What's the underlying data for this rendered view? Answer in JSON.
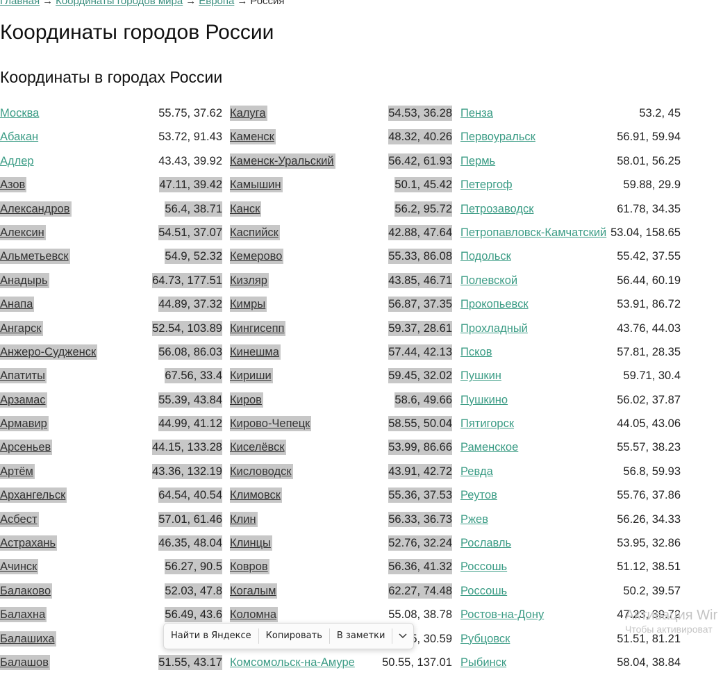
{
  "breadcrumb": {
    "items": [
      "Главная",
      "Координаты городов мира",
      "Европа"
    ],
    "current": "Россия",
    "separator": "→"
  },
  "page_title": "Координаты городов России",
  "section_title": "Координаты в городах России",
  "colors": {
    "link": "#3b9c85",
    "selection": "#c7c7c7"
  },
  "columns": [
    [
      {
        "name": "Москва",
        "coords": "55.75, 37.62",
        "sel": false
      },
      {
        "name": "Абакан",
        "coords": "53.72, 91.43",
        "sel": false
      },
      {
        "name": "Адлер",
        "coords": "43.43, 39.92",
        "sel": false
      },
      {
        "name": "Азов",
        "coords": "47.11, 39.42",
        "sel": true
      },
      {
        "name": "Александров",
        "coords": "56.4, 38.71",
        "sel": true
      },
      {
        "name": "Алексин",
        "coords": "54.51, 37.07",
        "sel": true
      },
      {
        "name": "Альметьевск",
        "coords": "54.9, 52.32",
        "sel": true
      },
      {
        "name": "Анадырь",
        "coords": "64.73, 177.51",
        "sel": true
      },
      {
        "name": "Анапа",
        "coords": "44.89, 37.32",
        "sel": true
      },
      {
        "name": "Ангарск",
        "coords": "52.54, 103.89",
        "sel": true
      },
      {
        "name": "Анжеро-Судженск",
        "coords": "56.08, 86.03",
        "sel": true
      },
      {
        "name": "Апатиты",
        "coords": "67.56, 33.4",
        "sel": true
      },
      {
        "name": "Арзамас",
        "coords": "55.39, 43.84",
        "sel": true
      },
      {
        "name": "Армавир",
        "coords": "44.99, 41.12",
        "sel": true
      },
      {
        "name": "Арсеньев",
        "coords": "44.15, 133.28",
        "sel": true
      },
      {
        "name": "Артём",
        "coords": "43.36, 132.19",
        "sel": true
      },
      {
        "name": "Архангельск",
        "coords": "64.54, 40.54",
        "sel": true
      },
      {
        "name": "Асбест",
        "coords": "57.01, 61.46",
        "sel": true
      },
      {
        "name": "Астрахань",
        "coords": "46.35, 48.04",
        "sel": true
      },
      {
        "name": "Ачинск",
        "coords": "56.27, 90.5",
        "sel": true
      },
      {
        "name": "Балаково",
        "coords": "52.03, 47.8",
        "sel": true
      },
      {
        "name": "Балахна",
        "coords": "56.49, 43.6",
        "sel": true
      },
      {
        "name": "Балашиха",
        "coords": "5",
        "sel": true
      },
      {
        "name": "Балашов",
        "coords": "51.55, 43.17",
        "sel": true
      }
    ],
    [
      {
        "name": "Калуга",
        "coords": "54.53, 36.28",
        "sel": true
      },
      {
        "name": "Каменск",
        "coords": "48.32, 40.26",
        "sel": true
      },
      {
        "name": "Каменск-Уральский",
        "coords": "56.42, 61.93",
        "sel": true
      },
      {
        "name": "Камышин",
        "coords": "50.1, 45.42",
        "sel": true
      },
      {
        "name": "Канск",
        "coords": "56.2, 95.72",
        "sel": true
      },
      {
        "name": "Каспийск",
        "coords": "42.88, 47.64",
        "sel": true
      },
      {
        "name": "Кемерово",
        "coords": "55.33, 86.08",
        "sel": true
      },
      {
        "name": "Кизляр",
        "coords": "43.85, 46.71",
        "sel": true
      },
      {
        "name": "Кимры",
        "coords": "56.87, 37.35",
        "sel": true
      },
      {
        "name": "Кингисепп",
        "coords": "59.37, 28.61",
        "sel": true
      },
      {
        "name": "Кинешма",
        "coords": "57.44, 42.13",
        "sel": true
      },
      {
        "name": "Кириши",
        "coords": "59.45, 32.02",
        "sel": true
      },
      {
        "name": "Киров",
        "coords": "58.6, 49.66",
        "sel": true
      },
      {
        "name": "Кирово-Чепецк",
        "coords": "58.55, 50.04",
        "sel": true
      },
      {
        "name": "Киселёвск",
        "coords": "53.99, 86.66",
        "sel": true
      },
      {
        "name": "Кисловодск",
        "coords": "43.91, 42.72",
        "sel": true
      },
      {
        "name": "Климовск",
        "coords": "55.36, 37.53",
        "sel": true
      },
      {
        "name": "Клин",
        "coords": "56.33, 36.73",
        "sel": true
      },
      {
        "name": "Клинцы",
        "coords": "52.76, 32.24",
        "sel": true
      },
      {
        "name": "Ковров",
        "coords": "56.36, 41.32",
        "sel": true
      },
      {
        "name": "Когалым",
        "coords": "62.27, 74.48",
        "sel": true
      },
      {
        "name": "Коломна",
        "coords": "55.08, 38.78",
        "sel": true,
        "coords_sel": false
      },
      {
        "name": "",
        "coords": "59.75, 30.59",
        "sel": false
      },
      {
        "name": "Комсомольск-на-Амуре",
        "coords": "50.55, 137.01",
        "sel": false
      }
    ],
    [
      {
        "name": "Пенза",
        "coords": "53.2, 45",
        "sel": false
      },
      {
        "name": "Первоуральск",
        "coords": "56.91, 59.94",
        "sel": false
      },
      {
        "name": "Пермь",
        "coords": "58.01, 56.25",
        "sel": false
      },
      {
        "name": "Петергоф",
        "coords": "59.88, 29.9",
        "sel": false
      },
      {
        "name": "Петрозаводск",
        "coords": "61.78, 34.35",
        "sel": false
      },
      {
        "name": "Петропавловск-Камчатский",
        "coords": "53.04, 158.65",
        "sel": false
      },
      {
        "name": "Подольск",
        "coords": "55.42, 37.55",
        "sel": false
      },
      {
        "name": "Полевской",
        "coords": "56.44, 60.19",
        "sel": false
      },
      {
        "name": "Прокопьевск",
        "coords": "53.91, 86.72",
        "sel": false
      },
      {
        "name": "Прохладный",
        "coords": "43.76, 44.03",
        "sel": false
      },
      {
        "name": "Псков",
        "coords": "57.81, 28.35",
        "sel": false
      },
      {
        "name": "Пушкин",
        "coords": "59.71, 30.4",
        "sel": false
      },
      {
        "name": "Пушкино",
        "coords": "56.02, 37.87",
        "sel": false
      },
      {
        "name": "Пятигорск",
        "coords": "44.05, 43.06",
        "sel": false
      },
      {
        "name": "Раменское",
        "coords": "55.57, 38.23",
        "sel": false
      },
      {
        "name": "Ревда",
        "coords": "56.8, 59.93",
        "sel": false
      },
      {
        "name": "Реутов",
        "coords": "55.76, 37.86",
        "sel": false
      },
      {
        "name": "Ржев",
        "coords": "56.26, 34.33",
        "sel": false
      },
      {
        "name": "Рославль",
        "coords": "53.95, 32.86",
        "sel": false
      },
      {
        "name": "Россошь",
        "coords": "51.12, 38.51",
        "sel": false
      },
      {
        "name": "Россошь",
        "coords": "50.2, 39.57",
        "sel": false
      },
      {
        "name": "Ростов-на-Дону",
        "coords": "47.23, 39.72",
        "sel": false
      },
      {
        "name": "Рубцовск",
        "coords": "51.51, 81.21",
        "sel": false
      },
      {
        "name": "Рыбинск",
        "coords": "58.04, 38.84",
        "sel": false
      }
    ]
  ],
  "context_menu": {
    "items": [
      "Найти в Яндексе",
      "Копировать",
      "В заметки"
    ],
    "more_icon": "chevron-down-icon"
  },
  "watermark": {
    "line1": "Активация Wir",
    "line2": "Чтобы активироват"
  }
}
